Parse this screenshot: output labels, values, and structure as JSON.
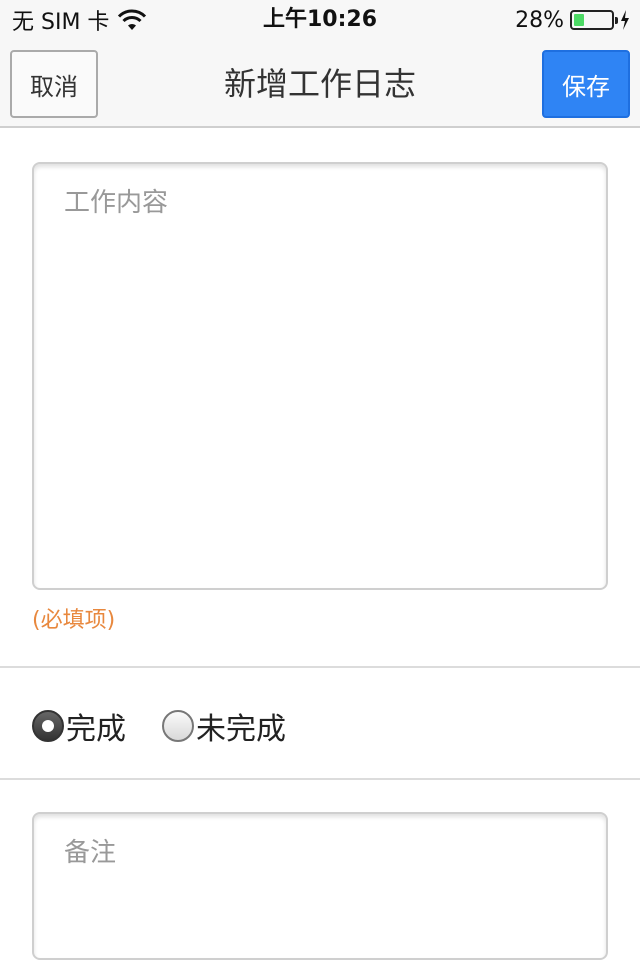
{
  "status_bar": {
    "carrier": "无 SIM 卡",
    "time": "上午10:26",
    "battery_text": "28%",
    "battery_level": 0.28,
    "wifi_icon": "wifi-icon",
    "charging_icon": "charging-bolt-icon"
  },
  "nav": {
    "cancel_label": "取消",
    "title": "新增工作日志",
    "save_label": "保存"
  },
  "form": {
    "content_placeholder": "工作内容",
    "content_value": "",
    "required_note": "(必填项)",
    "status_options": [
      {
        "label": "完成",
        "checked": true
      },
      {
        "label": "未完成",
        "checked": false
      }
    ],
    "note_placeholder": "备注",
    "note_value": ""
  },
  "colors": {
    "accent": "#2f84f4",
    "required": "#e8883e",
    "battery": "#4cd964"
  }
}
